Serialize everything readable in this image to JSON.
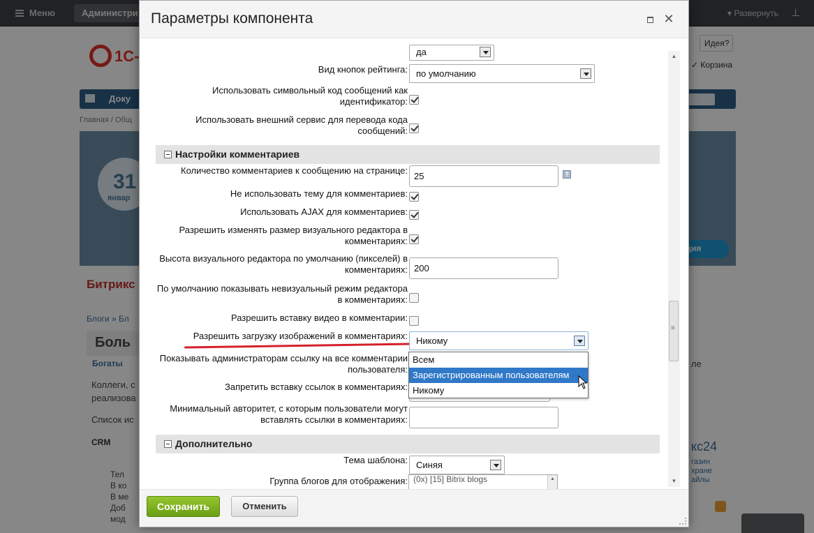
{
  "background": {
    "menu_label": "Меню",
    "admin_tab_label": "Администри",
    "expand_label": "Развернуть",
    "idea_label": "Идея?",
    "cart_label": "Корзина",
    "logo_text": "1С-",
    "nav_doc_label": "Доку",
    "breadcrumb_text": "Главная / Общ",
    "banner_circle_text": "31",
    "banner_sub_text": "январ",
    "banner_button_text": "ация",
    "page_title": "Битрикс",
    "blog_crumbs": "Блоги » Бл",
    "post_heading": "Боль",
    "author": "Богаты",
    "para1_line1": "Коллеги, с",
    "para1_line2": "реализова",
    "para2": "Список ис",
    "crm_label": "CRM",
    "bullets": [
      "Тел",
      "В ко",
      "В ме",
      "Доб",
      "мод"
    ],
    "right_brand": "кс24",
    "right_links": [
      "газин",
      "хране",
      "айлы"
    ],
    "right_side_text": "ле"
  },
  "dialog": {
    "title": "Параметры компонента",
    "maximize_label": "maximize",
    "close_label": "close",
    "fields": {
      "top_select_value": "да",
      "rating_buttons_label": "Вид кнопок рейтинга:",
      "rating_buttons_value": "по умолчанию",
      "symbolic_code_label_1": "Использовать символьный код сообщений как",
      "symbolic_code_label_2": "идентификатор:",
      "translate_service_label_1": "Использовать внешний сервис для перевода кода",
      "translate_service_label_2": "сообщений:"
    },
    "section_comments": "Настройки комментариев",
    "comments": {
      "count_label": "Количество комментариев к сообщению на странице:",
      "count_value": "25",
      "no_theme_label": "Не использовать тему для комментариев:",
      "ajax_label": "Использовать AJAX для комментариев:",
      "resize_editor_label_1": "Разрешить изменять размер визуального редактора в",
      "resize_editor_label_2": "комментариях:",
      "editor_height_label_1": "Высота визуального редактора по умолчанию (пикселей) в",
      "editor_height_label_2": "комментариях:",
      "editor_height_value": "200",
      "nonvisual_label_1": "По умолчанию показывать невизуальный режим редактора",
      "nonvisual_label_2": "в комментариях:",
      "video_label": "Разрешить вставку видео в комментарии:",
      "images_label": "Разрешить загрузку изображений в комментариях:",
      "images_value": "Никому",
      "images_options": [
        "Всем",
        "Зарегистрированным пользователям",
        "Никому"
      ],
      "admin_link_label_1": "Показывать администраторам ссылку на все комментарии",
      "admin_link_label_2": "пользователя:",
      "forbid_links_label": "Запретить вставку ссылок в комментариях:",
      "min_authority_label_1": "Минимальный авторитет, с которым пользователи могут",
      "min_authority_label_2": "вставлять ссылки в комментариях:",
      "min_authority_value": ""
    },
    "section_extra": "Дополнительно",
    "extra": {
      "theme_label": "Тема шаблона:",
      "theme_value": "Синяя",
      "blog_groups_label": "Группа блогов для отображения:",
      "blog_groups_value": "(0x) [15] Bitrix blogs"
    },
    "save_label": "Сохранить",
    "cancel_label": "Отменить"
  },
  "colors": {
    "save_button": "#7cb41e",
    "highlight": "#3078c8",
    "annotation_line": "#d4202a"
  }
}
